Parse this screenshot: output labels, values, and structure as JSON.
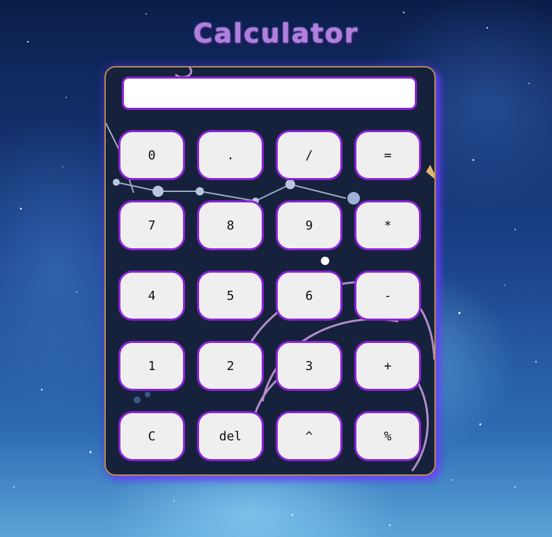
{
  "page": {
    "title": "Calculator"
  },
  "display": {
    "value": ""
  },
  "keys": [
    {
      "label": "0",
      "name": "key-0"
    },
    {
      "label": ".",
      "name": "key-decimal"
    },
    {
      "label": "/",
      "name": "key-divide"
    },
    {
      "label": "=",
      "name": "key-equals"
    },
    {
      "label": "7",
      "name": "key-7"
    },
    {
      "label": "8",
      "name": "key-8"
    },
    {
      "label": "9",
      "name": "key-9"
    },
    {
      "label": "*",
      "name": "key-multiply"
    },
    {
      "label": "4",
      "name": "key-4"
    },
    {
      "label": "5",
      "name": "key-5"
    },
    {
      "label": "6",
      "name": "key-6"
    },
    {
      "label": "-",
      "name": "key-subtract"
    },
    {
      "label": "1",
      "name": "key-1"
    },
    {
      "label": "2",
      "name": "key-2"
    },
    {
      "label": "3",
      "name": "key-3"
    },
    {
      "label": "+",
      "name": "key-add"
    },
    {
      "label": "C",
      "name": "key-clear"
    },
    {
      "label": "del",
      "name": "key-delete"
    },
    {
      "label": "^",
      "name": "key-power"
    },
    {
      "label": "%",
      "name": "key-percent"
    }
  ],
  "colors": {
    "title": "#b07fe0",
    "key_border": "#8a22d8",
    "key_bg": "#efefef",
    "panel_bg": "#16213b",
    "panel_border": "#b09050",
    "panel_glow": "#6e3cff"
  }
}
